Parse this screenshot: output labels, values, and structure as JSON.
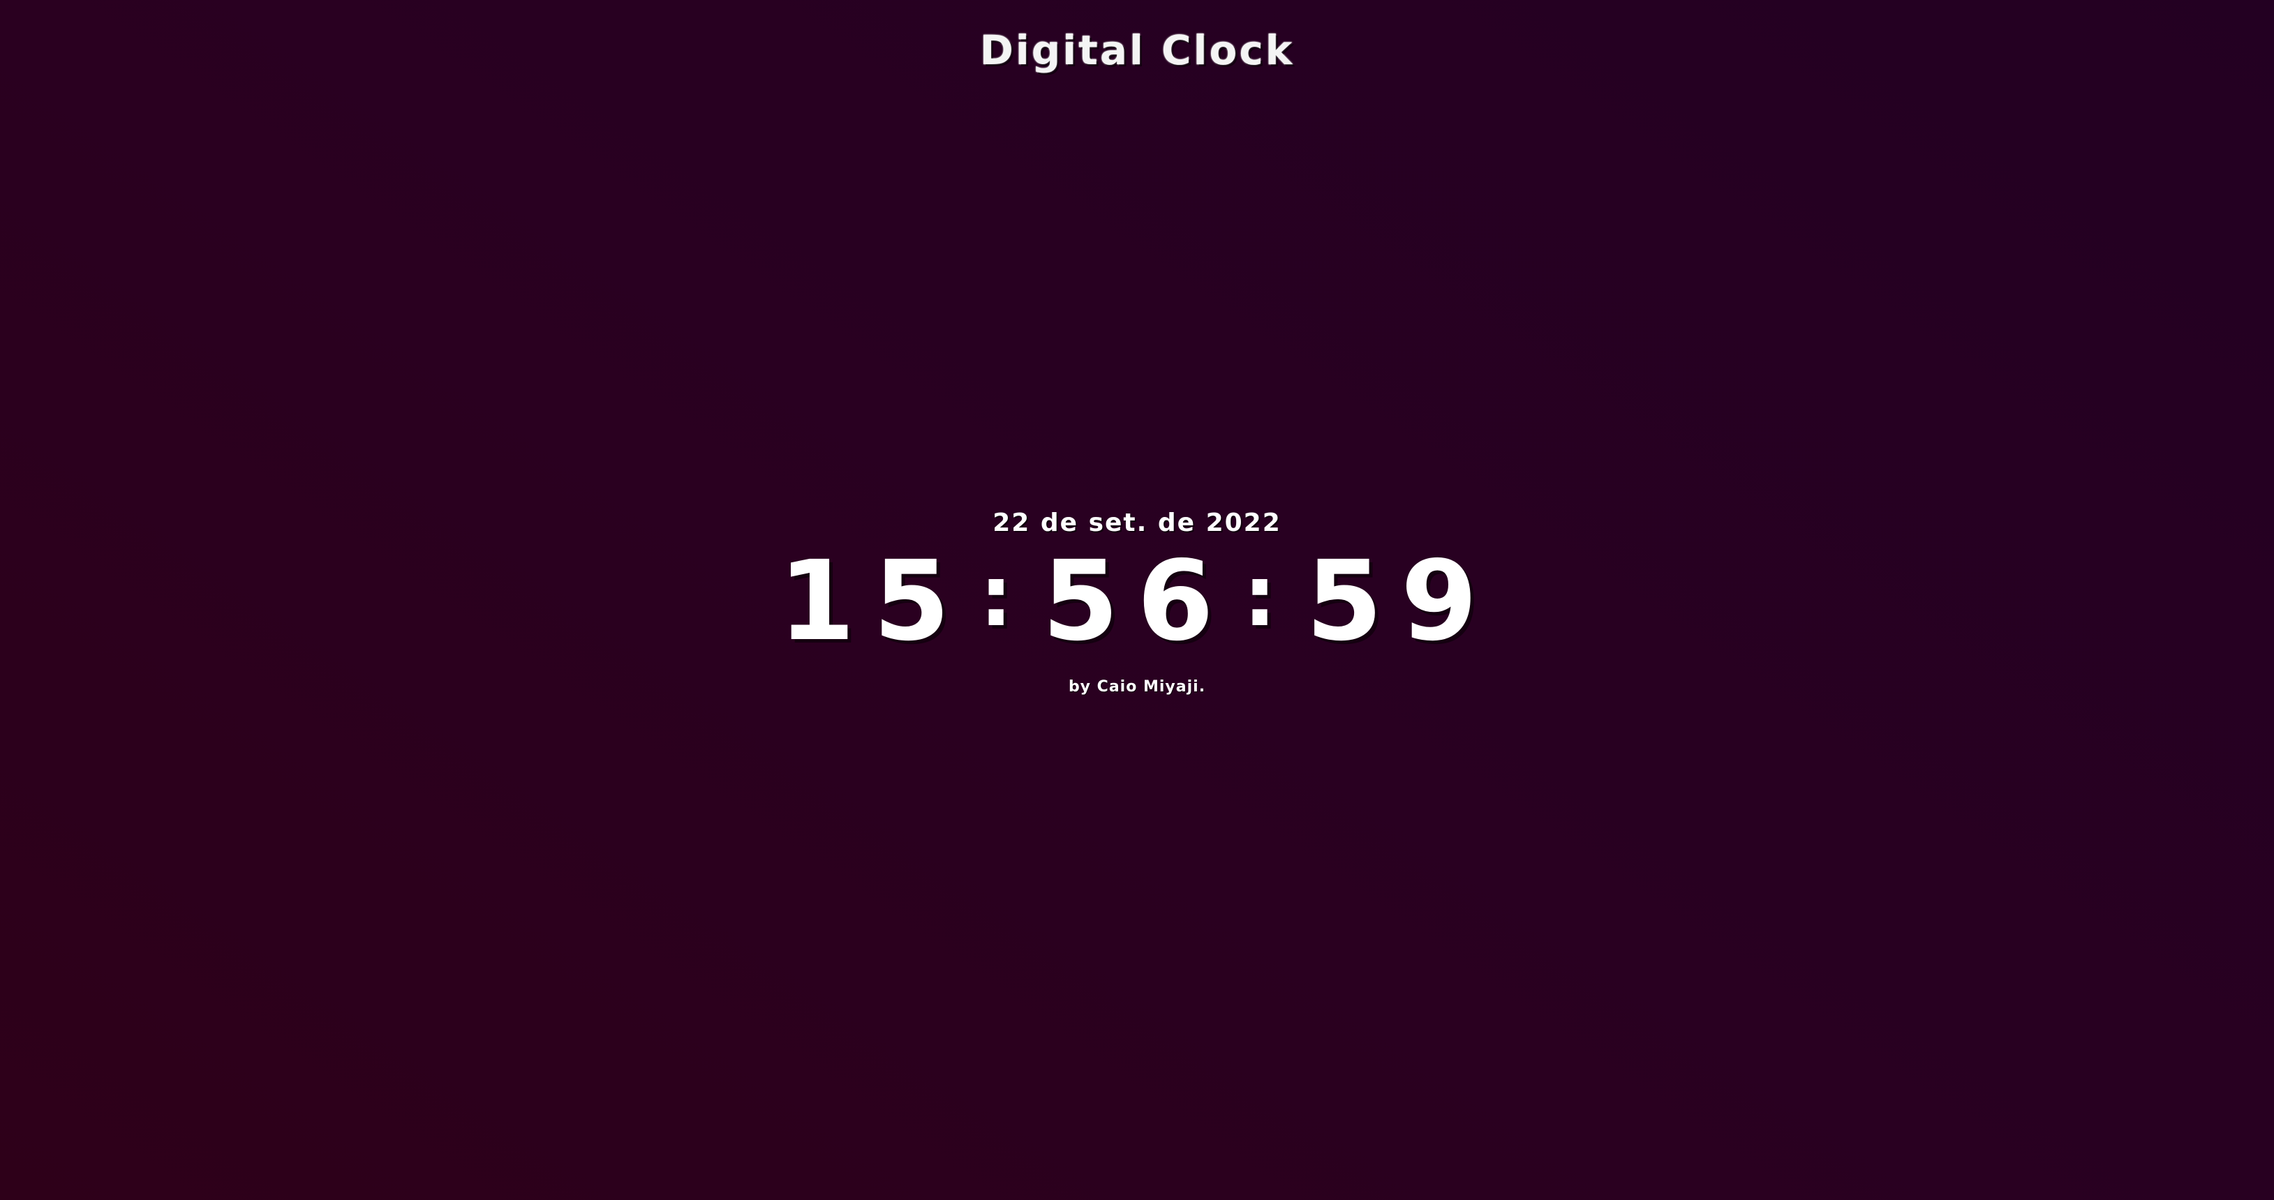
{
  "header": {
    "title": "Digital Clock"
  },
  "clock": {
    "date": "22 de set. de 2022",
    "hours": "15",
    "minutes": "56",
    "seconds": "59",
    "separator": ":"
  },
  "footer": {
    "author": "by Caio Miyaji."
  },
  "colors": {
    "background_start": "#2e0019",
    "background_end": "#230022",
    "text": "#ffffff"
  }
}
